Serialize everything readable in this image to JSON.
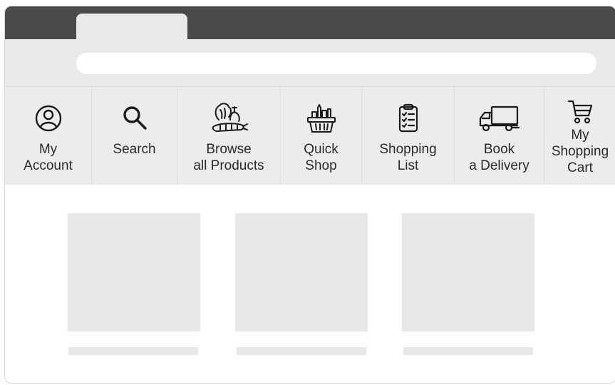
{
  "window": {
    "tab_title": "",
    "address_bar_value": ""
  },
  "nav": {
    "items": [
      {
        "label": "My\nAccount",
        "icon": "user-circle-icon"
      },
      {
        "label": "Search",
        "icon": "search-icon"
      },
      {
        "label": "Browse\nall Products",
        "icon": "vegetables-icon"
      },
      {
        "label": "Quick\nShop",
        "icon": "basket-icon"
      },
      {
        "label": "Shopping\nList",
        "icon": "clipboard-list-icon"
      },
      {
        "label": "Book\na Delivery",
        "icon": "delivery-truck-icon"
      },
      {
        "label": "My\nShopping\nCart",
        "icon": "shopping-cart-icon"
      }
    ]
  },
  "colors": {
    "tabbar": "#4a4a4a",
    "chrome": "#e9e9e9",
    "placeholder": "#e8e8e8",
    "text": "#2a2a2a"
  }
}
